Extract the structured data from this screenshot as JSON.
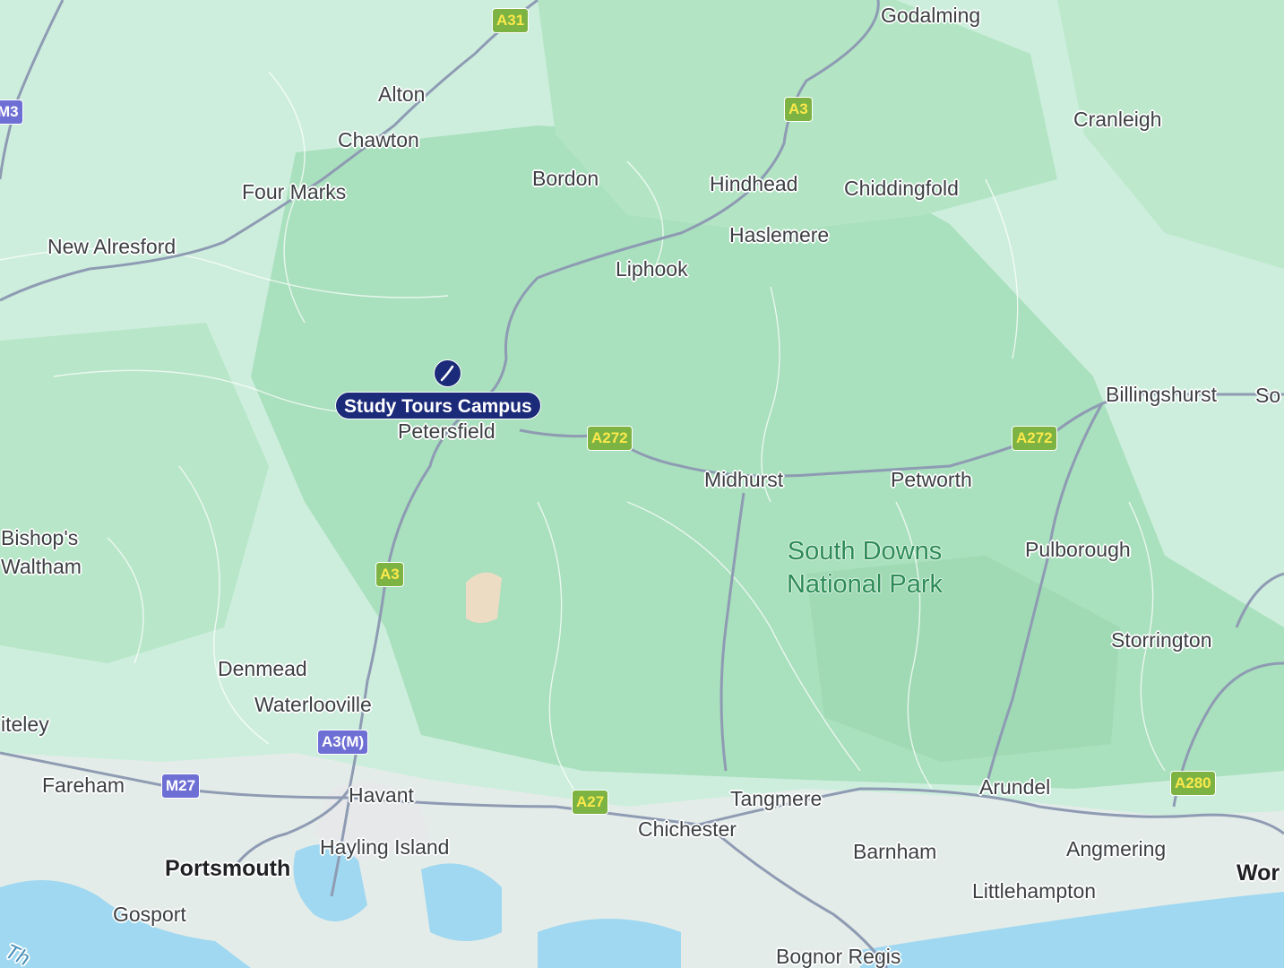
{
  "marker": {
    "label": "Study Tours Campus",
    "icon": "location-pin-icon",
    "color": "#1b2a79"
  },
  "national_park": {
    "name": "South Downs National Park"
  },
  "places": [
    {
      "name": "Godalming"
    },
    {
      "name": "Alton"
    },
    {
      "name": "Chawton"
    },
    {
      "name": "Cranleigh"
    },
    {
      "name": "Bordon"
    },
    {
      "name": "Hindhead"
    },
    {
      "name": "Chiddingfold"
    },
    {
      "name": "Four Marks"
    },
    {
      "name": "New Alresford"
    },
    {
      "name": "Haslemere"
    },
    {
      "name": "Liphook"
    },
    {
      "name": "Billingshurst"
    },
    {
      "name": "So"
    },
    {
      "name": "Petersfield"
    },
    {
      "name": "Midhurst"
    },
    {
      "name": "Petworth"
    },
    {
      "name": "Bishop's"
    },
    {
      "name": "Waltham"
    },
    {
      "name": "Pulborough"
    },
    {
      "name": "Storrington"
    },
    {
      "name": "Denmead"
    },
    {
      "name": "Waterlooville"
    },
    {
      "name": "iteley"
    },
    {
      "name": "Fareham"
    },
    {
      "name": "Havant"
    },
    {
      "name": "Tangmere"
    },
    {
      "name": "Arundel"
    },
    {
      "name": "Chichester"
    },
    {
      "name": "Hayling Island"
    },
    {
      "name": "Barnham"
    },
    {
      "name": "Angmering"
    },
    {
      "name": "Portsmouth"
    },
    {
      "name": "Wor"
    },
    {
      "name": "Littlehampton"
    },
    {
      "name": "Gosport"
    },
    {
      "name": "Bognor Regis"
    },
    {
      "name": "Th"
    }
  ],
  "road_shields": [
    {
      "ref": "A31",
      "type": "primary"
    },
    {
      "ref": "M3",
      "type": "motorway"
    },
    {
      "ref": "A3",
      "type": "primary"
    },
    {
      "ref": "A272",
      "type": "primary"
    },
    {
      "ref": "A272",
      "type": "primary"
    },
    {
      "ref": "A3",
      "type": "primary"
    },
    {
      "ref": "A3(M)",
      "type": "motorway"
    },
    {
      "ref": "M27",
      "type": "motorway"
    },
    {
      "ref": "A27",
      "type": "primary"
    },
    {
      "ref": "A280",
      "type": "primary"
    }
  ],
  "colors": {
    "land": "#cdeedd",
    "park": "#a7dfbb",
    "urban": "#e8eef0",
    "water": "#9fd8f0",
    "road": "#8e9bb3",
    "primary_shield": "#7cb342",
    "motorway_shield": "#6e6fd4"
  }
}
